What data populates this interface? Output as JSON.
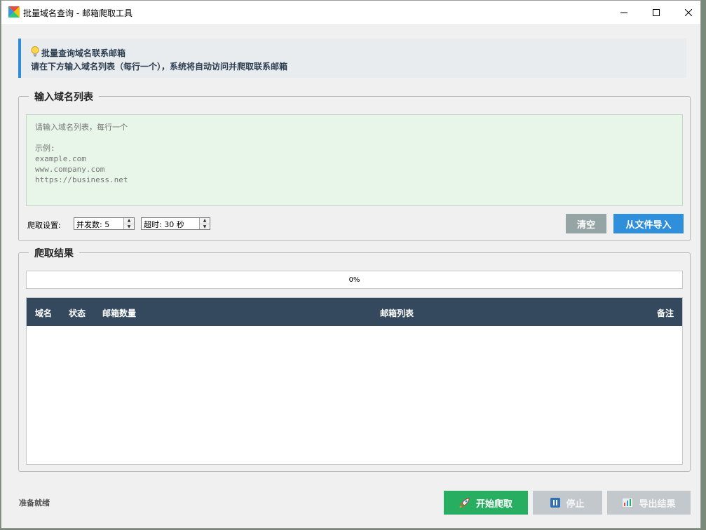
{
  "window": {
    "title": "批量域名查询 - 邮箱爬取工具"
  },
  "banner": {
    "title": "批量查询域名联系邮箱",
    "description": "请在下方输入域名列表（每行一个），系统将自动访问并爬取联系邮箱"
  },
  "input_group": {
    "title": "输入域名列表",
    "placeholder": "请输入域名列表，每行一个\n\n示例:\nexample.com\nwww.company.com\nhttps://business.net",
    "value": "",
    "settings_label": "爬取设置:",
    "concurrency": "并发数: 5",
    "timeout": "超时: 30 秒",
    "clear_label": "清空",
    "import_label": "从文件导入"
  },
  "results_group": {
    "title": "爬取结果",
    "progress_text": "0%",
    "progress_value": 0,
    "columns": [
      "域名",
      "状态",
      "邮箱数量",
      "邮箱列表",
      "备注"
    ],
    "rows": []
  },
  "footer": {
    "status": "准备就绪",
    "start_label": "开始爬取",
    "stop_label": "停止",
    "export_label": "导出结果"
  },
  "colors": {
    "accent_blue": "#2f8fdb",
    "start_green": "#27ae60",
    "header_dark": "#34495e",
    "input_bg": "#e8f5e9",
    "disabled_gray": "#c3c8cc"
  }
}
